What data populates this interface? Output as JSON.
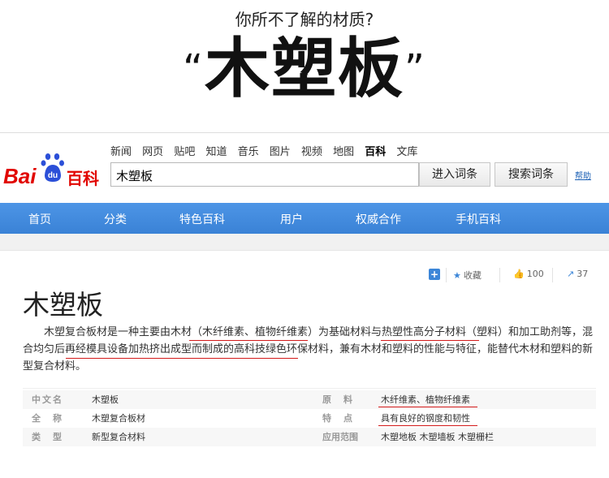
{
  "poster": {
    "subtitle": "你所不了解的材质?",
    "quote_open": "“",
    "title": "木塑板",
    "quote_close": "”"
  },
  "logo": {
    "brand": "Bai",
    "du": "du",
    "baike": "百科"
  },
  "topnav": [
    "新闻",
    "网页",
    "贴吧",
    "知道",
    "音乐",
    "图片",
    "视频",
    "地图",
    "百科",
    "文库"
  ],
  "search": {
    "value": "木塑板",
    "btn_enter": "进入词条",
    "btn_search": "搜索词条",
    "help": "帮助"
  },
  "mainnav": [
    "首页",
    "分类",
    "特色百科",
    "用户",
    "权威合作",
    "手机百科"
  ],
  "tools": {
    "fav": "收藏",
    "likes": "100",
    "shares": "37"
  },
  "page": {
    "title": "木塑板",
    "desc": "木塑复合板材是一种主要由木材（木纤维素、植物纤维素）为基础材料与热塑性高分子材料（塑料）和加工助剂等，混合均匀后再经模具设备加热挤出成型而制成的高科技绿色环保材料，兼有木材和塑料的性能与特征，能替代木材和塑料的新型复合材料。"
  },
  "info": {
    "left": [
      {
        "key": "中文名",
        "value": "木塑板"
      },
      {
        "key": "全　称",
        "value": "木塑复合板材"
      },
      {
        "key": "类　型",
        "value": "新型复合材料"
      }
    ],
    "right": [
      {
        "key": "原　料",
        "value": "木纤维素、植物纤维素"
      },
      {
        "key": "特　点",
        "value": "具有良好的钢度和韧性"
      },
      {
        "key": "应用范围",
        "value": "木塑地板 木塑墙板 木塑栅栏"
      }
    ]
  },
  "colors": {
    "accent": "#3c86d8",
    "brand_red": "#e10601",
    "underline": "#d31a1a"
  }
}
